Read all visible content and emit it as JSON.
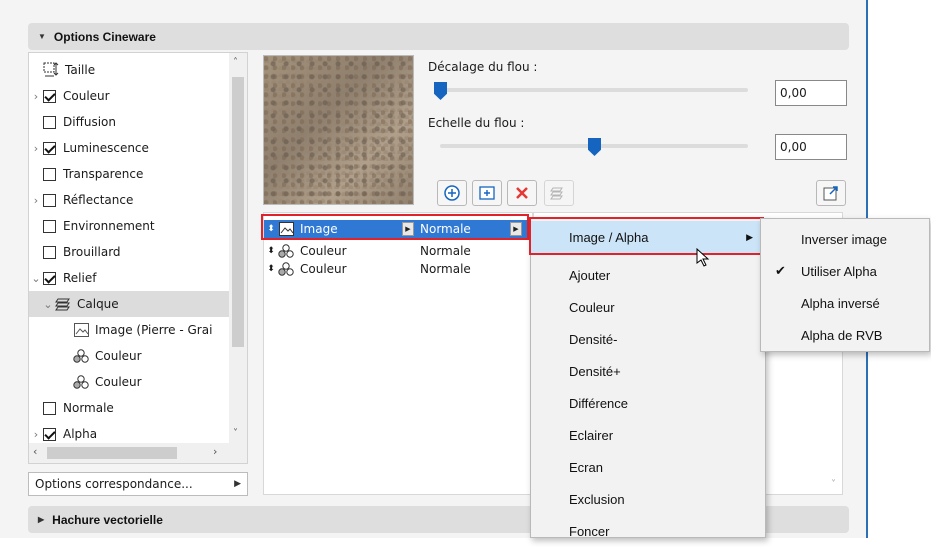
{
  "sections": {
    "top": "Options Cineware",
    "bottom": "Hachure vectorielle"
  },
  "tree": {
    "items": [
      {
        "label": "Taille",
        "checkbox": null,
        "chevron": "",
        "icon": "size-icon"
      },
      {
        "label": "Couleur",
        "checkbox": true,
        "chevron": ">",
        "icon": null
      },
      {
        "label": "Diffusion",
        "checkbox": false,
        "chevron": "",
        "icon": null
      },
      {
        "label": "Luminescence",
        "checkbox": true,
        "chevron": ">",
        "icon": null
      },
      {
        "label": "Transparence",
        "checkbox": false,
        "chevron": "",
        "icon": null
      },
      {
        "label": "Réflectance",
        "checkbox": false,
        "chevron": ">",
        "icon": null
      },
      {
        "label": "Environnement",
        "checkbox": false,
        "chevron": "",
        "icon": null
      },
      {
        "label": "Brouillard",
        "checkbox": false,
        "chevron": "",
        "icon": null
      },
      {
        "label": "Relief",
        "checkbox": true,
        "chevron": "v",
        "icon": null
      },
      {
        "label": "Calque",
        "checkbox": null,
        "chevron": "v",
        "icon": "layer-icon"
      },
      {
        "label": "Image (Pierre - Grai",
        "checkbox": null,
        "chevron": "",
        "icon": "image-icon"
      },
      {
        "label": "Couleur",
        "checkbox": null,
        "chevron": "",
        "icon": "color-node-icon"
      },
      {
        "label": "Couleur",
        "checkbox": null,
        "chevron": "",
        "icon": "color-node-icon"
      },
      {
        "label": "Normale",
        "checkbox": false,
        "chevron": "",
        "icon": null
      },
      {
        "label": "Alpha",
        "checkbox": true,
        "chevron": ">",
        "icon": null
      }
    ],
    "options_button": "Options correspondance..."
  },
  "sliders": {
    "blur_offset": {
      "label": "Décalage du flou :",
      "value": "0,00",
      "level": 0.0
    },
    "blur_scale": {
      "label": "Echelle du flou :",
      "value": "0,00",
      "level": 0.5
    }
  },
  "toolbar": {
    "buttons": [
      "add-shader-icon",
      "add-folder-icon",
      "delete-icon",
      "link-icon",
      "export-icon"
    ]
  },
  "layers": [
    {
      "name": "Image",
      "mode": "Normale",
      "selected": true
    },
    {
      "name": "Couleur",
      "mode": "Normale",
      "selected": false
    },
    {
      "name": "Couleur",
      "mode": "Normale",
      "selected": false
    }
  ],
  "blend_menu": {
    "items": [
      "Image / Alpha",
      "Ajouter",
      "Couleur",
      "Densité-",
      "Densité+",
      "Différence",
      "Eclairer",
      "Ecran",
      "Exclusion",
      "Foncer"
    ],
    "highlighted": "Image / Alpha"
  },
  "alpha_submenu": {
    "items": [
      "Inverser image",
      "Utiliser Alpha",
      "Alpha inversé",
      "Alpha de RVB"
    ],
    "checked": "Utiliser Alpha"
  },
  "colors": {
    "accent": "#1565c0",
    "selection": "#2f78d4",
    "highlight_box": "#e0222a"
  }
}
